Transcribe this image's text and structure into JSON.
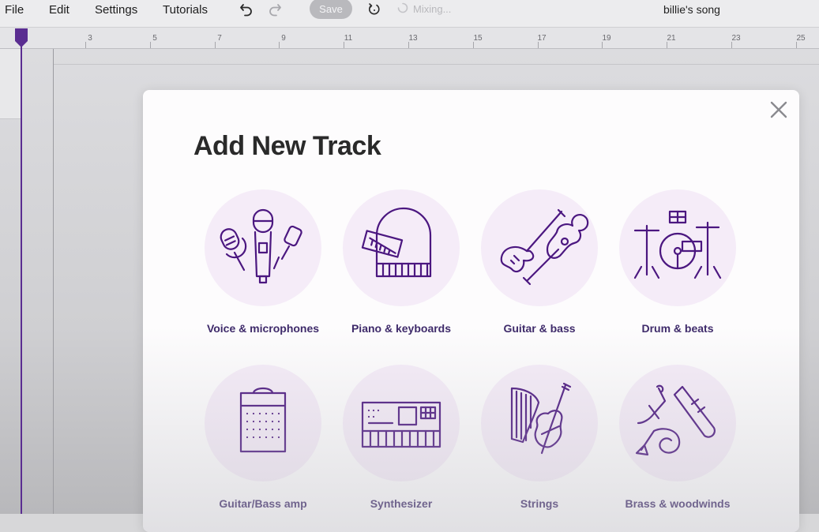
{
  "menu": {
    "file": "File",
    "edit": "Edit",
    "settings": "Settings",
    "tutorials": "Tutorials"
  },
  "toolbar": {
    "undo_icon": "undo-icon",
    "redo_icon": "redo-icon",
    "save_label": "Save",
    "refresh_icon": "refresh-icon",
    "mixing_label": "Mixing...",
    "song_title": "billie's song"
  },
  "ruler": {
    "labels": [
      "3",
      "5",
      "7",
      "9",
      "11",
      "13",
      "15",
      "17",
      "19",
      "21",
      "23",
      "25"
    ]
  },
  "modal": {
    "title": "Add New Track",
    "close_icon": "close-icon",
    "tracks": [
      {
        "label": "Voice & microphones",
        "icon": "microphones-icon"
      },
      {
        "label": "Piano & keyboards",
        "icon": "piano-icon"
      },
      {
        "label": "Guitar & bass",
        "icon": "guitar-icon"
      },
      {
        "label": "Drum & beats",
        "icon": "drums-icon"
      },
      {
        "label": "Guitar/Bass amp",
        "icon": "amp-icon"
      },
      {
        "label": "Synthesizer",
        "icon": "synthesizer-icon"
      },
      {
        "label": "Strings",
        "icon": "strings-icon"
      },
      {
        "label": "Brass & woodwinds",
        "icon": "brass-icon"
      }
    ]
  },
  "colors": {
    "accent": "#4b1780",
    "playhead": "#5a2d91",
    "tile_bg": "#f5ecf8",
    "label": "#3e2a6a"
  }
}
